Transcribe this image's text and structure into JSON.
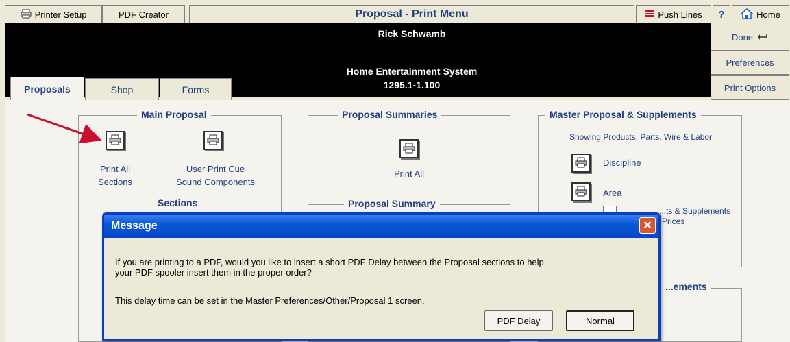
{
  "toolbar": {
    "printer_setup": "Printer Setup",
    "pdf_creator": "PDF Creator",
    "title": "Proposal - Print Menu",
    "push_lines": "Push Lines",
    "help": "?",
    "home": "Home"
  },
  "header": {
    "client": "Rick Schwamb",
    "project": "Home Entertainment System",
    "number": "1295.1-1.100"
  },
  "tabs": [
    "Proposals",
    "Shop",
    "Forms"
  ],
  "side_buttons": {
    "done": "Done",
    "preferences": "Preferences",
    "print_options": "Print Options"
  },
  "main_proposal": {
    "title": "Main Proposal",
    "print_all": [
      "Print All",
      "Sections"
    ],
    "user_print_cue": [
      "User Print Cue",
      "Sound Components"
    ],
    "sections": "Sections"
  },
  "proposal_summaries": {
    "title": "Proposal Summaries",
    "print_all": "Print All",
    "proposal_summary": "Proposal Summary"
  },
  "master": {
    "title": "Master Proposal & Supplements",
    "subtitle": "Showing Products, Parts, Wire & Labor",
    "discipline": "Discipline",
    "area": "Area",
    "partial_1": "...ts & Supplements",
    "partial_2": "Prices",
    "partial_title": "...ements"
  },
  "dialog": {
    "title": "Message",
    "line1": "If you are printing to a PDF, would you like to insert a short PDF Delay between the Proposal sections to help",
    "line2": "your PDF spooler insert them in the proper order?",
    "line3": "This delay time can be set in the Master Preferences/Other/Proposal 1 screen.",
    "pdf_delay": "PDF Delay",
    "normal": "Normal"
  },
  "colors": {
    "accent_red": "#c8102e",
    "dialog_blue": "#0a5ad5"
  }
}
